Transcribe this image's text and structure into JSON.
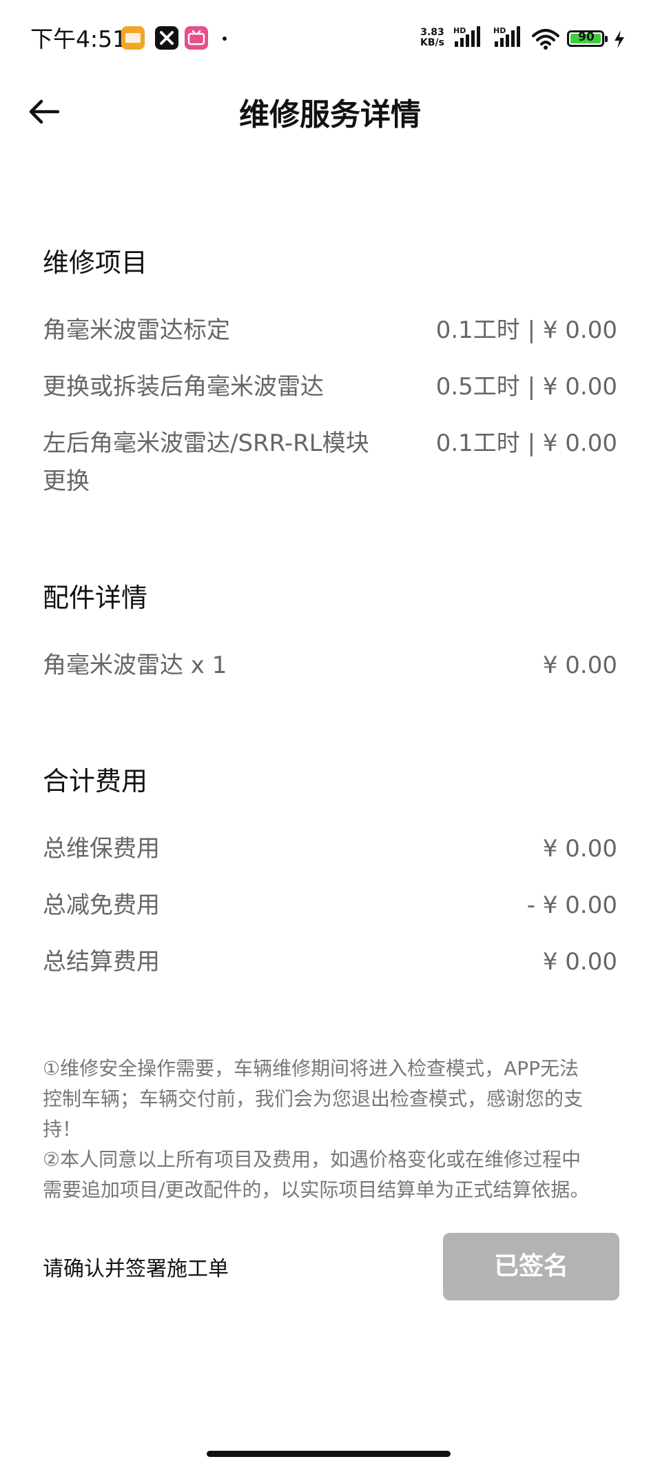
{
  "status_bar": {
    "time": "下午4:51",
    "net_speed_value": "3.83",
    "net_speed_unit": "KB/s",
    "signal_label_1": "HD",
    "signal_label_2": "HD",
    "battery_level": "90"
  },
  "header": {
    "title": "维修服务详情"
  },
  "repair_items": {
    "title": "维修项目",
    "rows": [
      {
        "label": "角毫米波雷达标定",
        "value": "0.1工时 | ¥ 0.00"
      },
      {
        "label": "更换或拆装后角毫米波雷达",
        "value": "0.5工时 | ¥ 0.00"
      },
      {
        "label_line1": "左后角毫米波雷达/SRR-RL模块",
        "label_line2": "更换",
        "value": "0.1工时 | ¥ 0.00"
      }
    ]
  },
  "parts": {
    "title": "配件详情",
    "rows": [
      {
        "label": "角毫米波雷达 x 1",
        "value": "¥ 0.00"
      }
    ]
  },
  "totals": {
    "title": "合计费用",
    "rows": [
      {
        "label": "总维保费用",
        "value": "¥ 0.00"
      },
      {
        "label": "总减免费用",
        "value": "- ¥ 0.00"
      },
      {
        "label": "总结算费用",
        "value": "¥ 0.00"
      }
    ]
  },
  "notice": {
    "line1": "①维修安全操作需要，车辆维修期间将进入检查模式，APP无法",
    "line2": "控制车辆；车辆交付前，我们会为您退出检查模式，感谢您的支",
    "line3": "持！",
    "line4": "②本人同意以上所有项目及费用，如遇价格变化或在维修过程中",
    "line5": "需要追加项目/更改配件的，以实际项目结算单为正式结算依据。"
  },
  "sign": {
    "label": "请确认并签署施工单",
    "button_label": "已签名"
  }
}
